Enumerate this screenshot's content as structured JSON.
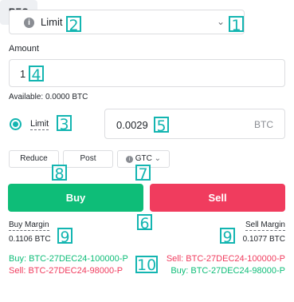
{
  "order_type": {
    "icon": "info-icon",
    "label": "Limit",
    "chevron_icon": "chevron-down-icon"
  },
  "rfq_button": "RFQ",
  "amount": {
    "label": "Amount",
    "value": "1"
  },
  "available": "Available: 0.0000 BTC",
  "limit_toggle": {
    "label": "Limit",
    "selected": true
  },
  "price": {
    "value": "0.0029",
    "unit": "BTC"
  },
  "options": {
    "reduce": "Reduce",
    "post": "Post",
    "gtc": "GTC"
  },
  "buy_button": "Buy",
  "sell_button": "Sell",
  "margins": {
    "buy_label": "Buy Margin",
    "buy_value": "0.1106 BTC",
    "sell_label": "Sell Margin",
    "sell_value": "0.1077 BTC"
  },
  "orders": {
    "left_buy": "Buy: BTC-27DEC24-100000-P",
    "left_sell": "Sell: BTC-27DEC24-98000-P",
    "right_sell": "Sell: BTC-27DEC24-100000-P",
    "right_buy": "Buy: BTC-27DEC24-98000-P"
  },
  "markers": [
    "1",
    "2",
    "3",
    "4",
    "5",
    "6",
    "7",
    "8",
    "9",
    "9",
    "10"
  ],
  "colors": {
    "buy": "#0ebd78",
    "sell": "#f03c5e",
    "accent": "#13b5b1"
  }
}
